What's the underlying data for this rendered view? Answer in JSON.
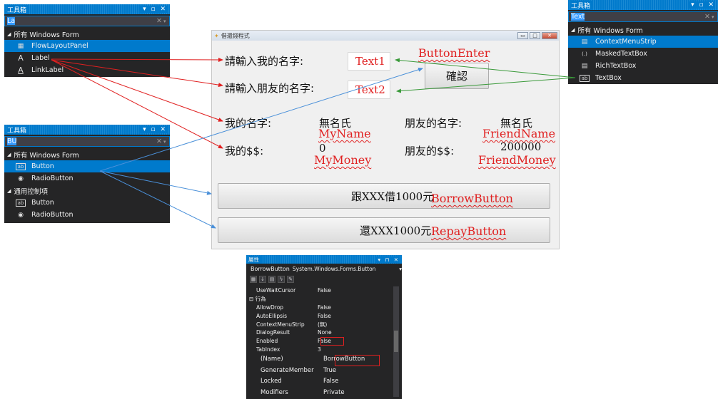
{
  "toolbox1": {
    "title": "工具箱",
    "controls": "▾ ▫ ✕",
    "search": "La",
    "category": "所有 Windows Form",
    "items": [
      {
        "icon": "▦",
        "label": "FlowLayoutPanel"
      },
      {
        "icon": "A",
        "label": "Label"
      },
      {
        "icon": "A",
        "label": "LinkLabel"
      }
    ]
  },
  "toolbox2": {
    "title": "工具箱",
    "controls": "▾ ▫ ✕",
    "search": "BU",
    "category1": "所有 Windows Form",
    "items1": [
      {
        "icon": "ab",
        "label": "Button"
      },
      {
        "icon": "◉",
        "label": "RadioButton"
      }
    ],
    "category2": "通用控制項",
    "items2": [
      {
        "icon": "ab",
        "label": "Button"
      },
      {
        "icon": "◉",
        "label": "RadioButton"
      }
    ]
  },
  "toolbox3": {
    "title": "工具箱",
    "controls": "▾ ▫ ✕",
    "search": "Text",
    "category": "所有 Windows Form",
    "items": [
      {
        "icon": "▤",
        "label": "ContextMenuStrip"
      },
      {
        "icon": "(.)",
        "label": "MaskedTextBox"
      },
      {
        "icon": "▤",
        "label": "RichTextBox"
      },
      {
        "icon": "ab",
        "label": "TextBox"
      }
    ]
  },
  "form": {
    "title": "借還錢程式",
    "label_my_name_prompt": "請輸入我的名字:",
    "label_friend_name_prompt": "請輸入朋友的名字:",
    "text1": "Text1",
    "text2": "Text2",
    "confirm_button": "確認",
    "label_my_name": "我的名字:",
    "my_name_value": "無名氏",
    "label_friend_name": "朋友的名字:",
    "friend_name_value": "無名氏",
    "label_my_money": "我的$$:",
    "my_money_value": "0",
    "label_friend_money": "朋友的$$:",
    "friend_money_value": "200000",
    "borrow_button": "跟XXX借1000元",
    "repay_button": "還XXX1000元"
  },
  "annotations": {
    "button_enter": "ButtonEnter",
    "my_name": "MyName",
    "friend_name": "FriendName",
    "my_money": "MyMoney",
    "friend_money": "FriendMoney",
    "borrow_button": "BorrowButton",
    "repay_button": "RepayButton"
  },
  "properties": {
    "title": "屬性",
    "controls": "▾ ⊓ ✕",
    "object_name": "BorrowButton",
    "object_type": "System.Windows.Forms.Button",
    "rows": [
      {
        "k": "UseWaitCursor",
        "v": "False"
      },
      {
        "k": "⊟ 行為",
        "v": "",
        "cat": true
      },
      {
        "k": "AllowDrop",
        "v": "False"
      },
      {
        "k": "AutoEllipsis",
        "v": "False"
      },
      {
        "k": "ContextMenuStrip",
        "v": "(無)"
      },
      {
        "k": "DialogResult",
        "v": "None"
      },
      {
        "k": "Enabled",
        "v": "False"
      },
      {
        "k": "TabIndex",
        "v": "3"
      }
    ],
    "big_rows": [
      {
        "k": "(Name)",
        "v": "BorrowButton"
      },
      {
        "k": "GenerateMember",
        "v": "True"
      },
      {
        "k": "Locked",
        "v": "False"
      },
      {
        "k": "Modifiers",
        "v": "Private"
      }
    ]
  },
  "colors": {
    "accent": "#007acc",
    "panel_bg": "#252526",
    "annotation_red": "#e02020",
    "arrow_red": "#e02020",
    "arrow_blue": "#4a90d9",
    "arrow_green": "#3a9a3a"
  }
}
